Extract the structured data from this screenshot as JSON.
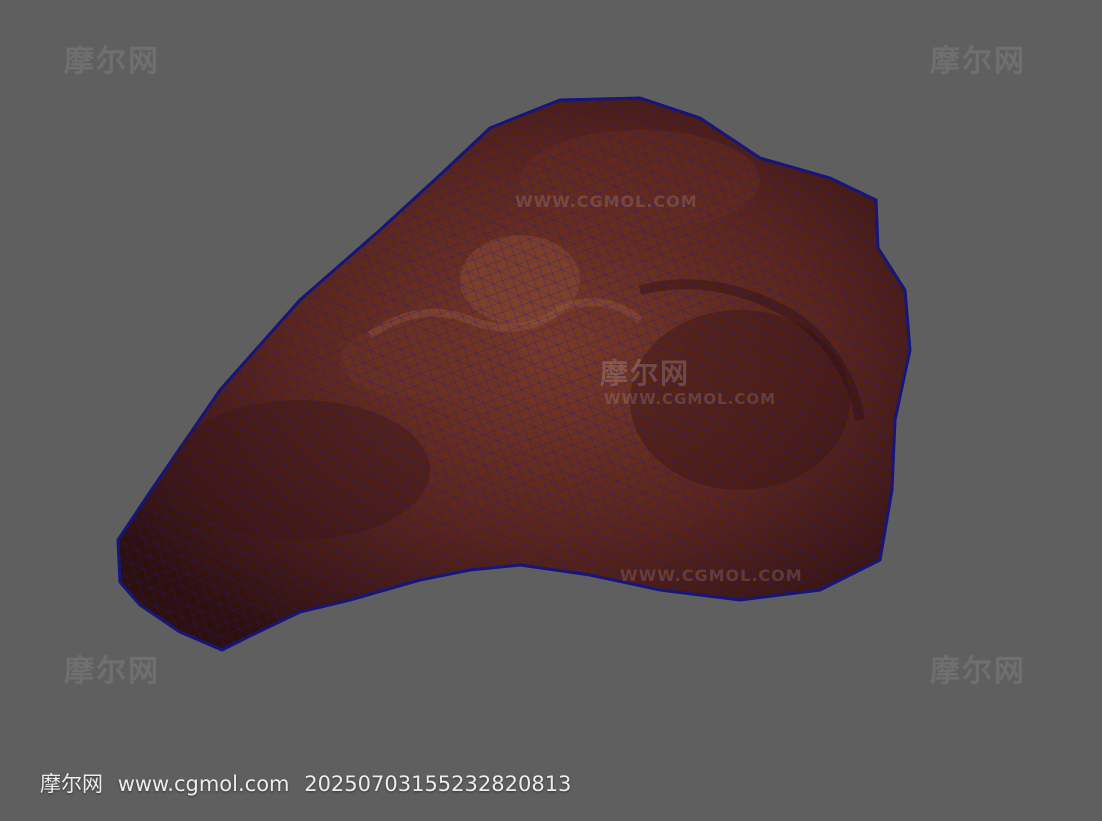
{
  "viewport": {
    "background_color": "#5f5f5f",
    "grid_color": "#3a3a3a",
    "grid_axis_color": "#222222",
    "wireframe_color": "#1a1a9a",
    "mesh_base_color": "#4a1d12",
    "mesh_highlight_color": "#7a3a25"
  },
  "watermarks": {
    "logo_text": "摩尔网",
    "url_text": "WWW.CGMOL.COM"
  },
  "caption": {
    "site_name": "摩尔网",
    "url": "www.cgmol.com",
    "id": "20250703155232820813"
  }
}
